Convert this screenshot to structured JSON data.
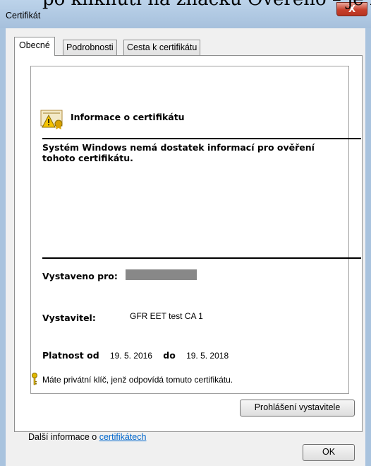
{
  "background_text": "po kliknutí na značku Ověřeno – je m",
  "window": {
    "title": "Certifikát",
    "close_glyph": "X"
  },
  "tabs": [
    {
      "label": "Obecné",
      "selected": true
    },
    {
      "label": "Podrobnosti",
      "selected": false
    },
    {
      "label": "Cesta k certifikátu",
      "selected": false
    }
  ],
  "cert": {
    "header_icon": "certificate-warning-icon",
    "header_title": "Informace o certifikátu",
    "warning": "Systém Windows nemá dostatek informací pro ověření tohoto certifikátu.",
    "issued_to_label": "Vystaveno pro:",
    "issuer_label": "Vystavitel:",
    "issuer_value": "GFR EET test CA 1",
    "valid_from_label": "Platnost od",
    "valid_from": "19. 5. 2016",
    "valid_to_label": "do",
    "valid_to": "19. 5. 2018",
    "key_icon": "key-icon",
    "private_key_note": "Máte privátní klíč, jenž odpovídá tomuto certifikátu."
  },
  "buttons": {
    "issuer_statement": "Prohlášení vystavitele",
    "ok": "OK"
  },
  "more_info": {
    "prefix": "Další informace o ",
    "link": "certifikátech"
  },
  "colors": {
    "link": "#0066cc",
    "title_bar": "#a9c3de",
    "close_button": "#c7402c",
    "redaction": "#888888"
  }
}
